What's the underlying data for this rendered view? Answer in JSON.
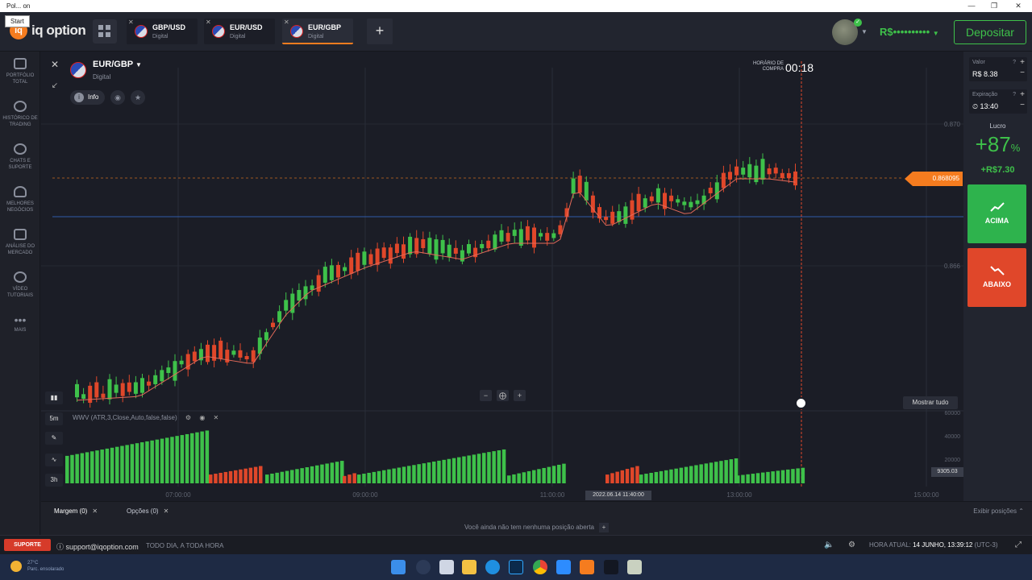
{
  "window": {
    "title": "on",
    "start_tip": "Start",
    "app_prefix": "Pol..."
  },
  "topbar": {
    "logo_text": "iq option",
    "tabs": [
      {
        "name": "GBP/USD",
        "kind": "Digital"
      },
      {
        "name": "EUR/USD",
        "kind": "Digital"
      },
      {
        "name": "EUR/GBP",
        "kind": "Digital"
      }
    ],
    "add_tab": "+",
    "balance": "R$••••••••••",
    "deposit_label": "Depositar"
  },
  "sidebar": {
    "items": [
      {
        "label": "PORTFÓLIO\nTOTAL",
        "icon": "briefcase-icon"
      },
      {
        "label": "HISTÓRICO DE\nTRADING",
        "icon": "history-icon"
      },
      {
        "label": "CHATS E\nSUPORTE",
        "icon": "chat-icon"
      },
      {
        "label": "MELHORES\nNEGÓCIOS",
        "icon": "trophy-icon"
      },
      {
        "label": "ANÁLISE DO\nMERCADO",
        "icon": "news-icon"
      },
      {
        "label": "VÍDEO\nTUTORIAIS",
        "icon": "play-icon"
      },
      {
        "label": "MAIS",
        "icon": "more-icon"
      }
    ]
  },
  "asset": {
    "name": "EUR/GBP",
    "kind": "Digital",
    "info_label": "Info"
  },
  "purchase_time": {
    "label": "HORÁRIO DE\nCOMPRA",
    "value": "00:18"
  },
  "chart": {
    "price_levels": [
      "0.870",
      "0.866"
    ],
    "current_price": "0.868095",
    "time_labels": [
      "07:00:00",
      "09:00:00",
      "11:00:00",
      "13:00:00",
      "15:00:00"
    ],
    "cursor_date": "2022.06.14 11:40:00",
    "show_all": "Mostrar tudo",
    "timeframe": "5m",
    "period": "3h",
    "indicator": "WWV (ATR,3,Close,Auto,false,false)",
    "volume_levels": [
      "60000",
      "40000",
      "20000"
    ],
    "volume_current": "9305.03",
    "colors": {
      "up": "#3ec14a",
      "down": "#e0472a",
      "accent": "#f57c1f"
    }
  },
  "trade_panel": {
    "value_label": "Valor",
    "value": "R$ 8.38",
    "expiry_label": "Expiração",
    "expiry": "⏲ 13:40",
    "profit_label": "Lucro",
    "profit_pct": "+87",
    "profit_pct_unit": "%",
    "profit_value": "+R$7.30",
    "up_label": "ACIMA",
    "down_label": "ABAIXO"
  },
  "bottom": {
    "tab_margin": "Margem (0)",
    "tab_options": "Opções (0)",
    "no_positions": "Você ainda não tem nenhuma posição aberta",
    "show_positions": "Exibir posições"
  },
  "status": {
    "support_label": "SUPORTE",
    "support_mail": "support@iqoption.com",
    "support_hours": "TODO DIA, A TODA HORA",
    "hora_label": "HORA ATUAL:",
    "hora_value": "14 JUNHO, 13:39:12",
    "timezone": "(UTC-3)"
  },
  "taskbar": {
    "weather": "27°C\nParc. ensolarado"
  }
}
